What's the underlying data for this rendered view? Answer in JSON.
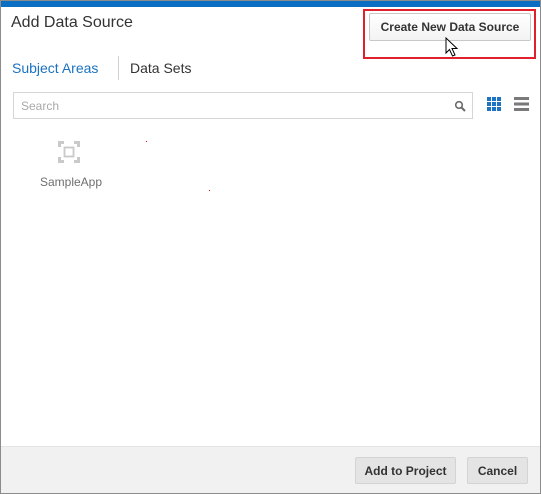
{
  "dialog": {
    "title": "Add Data Source",
    "create_button_label": "Create New Data Source"
  },
  "tabs": [
    {
      "label": "Subject Areas",
      "active": true
    },
    {
      "label": "Data Sets",
      "active": false
    }
  ],
  "search": {
    "placeholder": "Search",
    "value": ""
  },
  "view_toggle": {
    "selected": "grid-view-icon",
    "options": [
      "grid-view-icon",
      "list-view-icon"
    ]
  },
  "items": [
    {
      "label": "SampleApp",
      "icon": "subject-area-icon"
    }
  ],
  "footer": {
    "add_label": "Add to Project",
    "cancel_label": "Cancel"
  },
  "colors": {
    "accent": "#0a6fc2",
    "tab_active": "#1a72c0",
    "highlight": "#e0202a"
  }
}
